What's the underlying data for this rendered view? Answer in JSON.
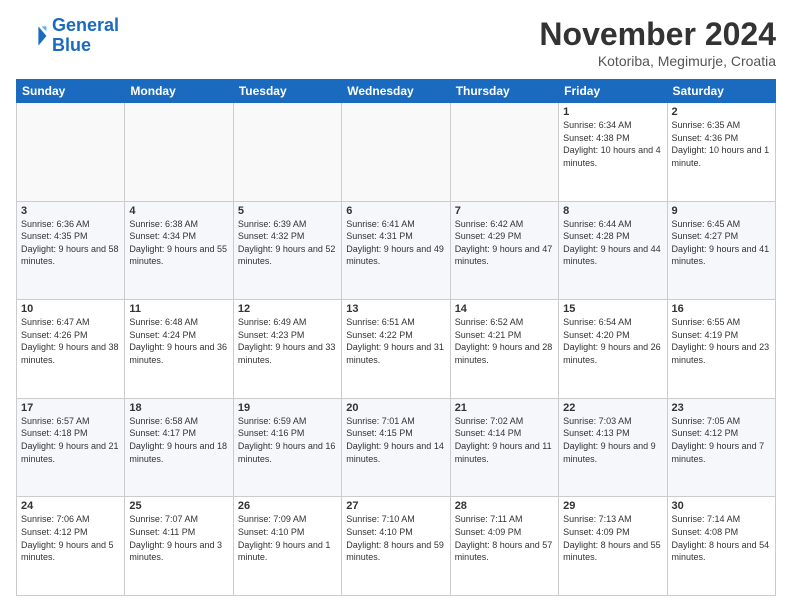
{
  "logo": {
    "line1": "General",
    "line2": "Blue"
  },
  "title": "November 2024",
  "subtitle": "Kotoriba, Megimurje, Croatia",
  "weekdays": [
    "Sunday",
    "Monday",
    "Tuesday",
    "Wednesday",
    "Thursday",
    "Friday",
    "Saturday"
  ],
  "weeks": [
    [
      {
        "day": "",
        "info": ""
      },
      {
        "day": "",
        "info": ""
      },
      {
        "day": "",
        "info": ""
      },
      {
        "day": "",
        "info": ""
      },
      {
        "day": "",
        "info": ""
      },
      {
        "day": "1",
        "info": "Sunrise: 6:34 AM\nSunset: 4:38 PM\nDaylight: 10 hours\nand 4 minutes."
      },
      {
        "day": "2",
        "info": "Sunrise: 6:35 AM\nSunset: 4:36 PM\nDaylight: 10 hours\nand 1 minute."
      }
    ],
    [
      {
        "day": "3",
        "info": "Sunrise: 6:36 AM\nSunset: 4:35 PM\nDaylight: 9 hours\nand 58 minutes."
      },
      {
        "day": "4",
        "info": "Sunrise: 6:38 AM\nSunset: 4:34 PM\nDaylight: 9 hours\nand 55 minutes."
      },
      {
        "day": "5",
        "info": "Sunrise: 6:39 AM\nSunset: 4:32 PM\nDaylight: 9 hours\nand 52 minutes."
      },
      {
        "day": "6",
        "info": "Sunrise: 6:41 AM\nSunset: 4:31 PM\nDaylight: 9 hours\nand 49 minutes."
      },
      {
        "day": "7",
        "info": "Sunrise: 6:42 AM\nSunset: 4:29 PM\nDaylight: 9 hours\nand 47 minutes."
      },
      {
        "day": "8",
        "info": "Sunrise: 6:44 AM\nSunset: 4:28 PM\nDaylight: 9 hours\nand 44 minutes."
      },
      {
        "day": "9",
        "info": "Sunrise: 6:45 AM\nSunset: 4:27 PM\nDaylight: 9 hours\nand 41 minutes."
      }
    ],
    [
      {
        "day": "10",
        "info": "Sunrise: 6:47 AM\nSunset: 4:26 PM\nDaylight: 9 hours\nand 38 minutes."
      },
      {
        "day": "11",
        "info": "Sunrise: 6:48 AM\nSunset: 4:24 PM\nDaylight: 9 hours\nand 36 minutes."
      },
      {
        "day": "12",
        "info": "Sunrise: 6:49 AM\nSunset: 4:23 PM\nDaylight: 9 hours\nand 33 minutes."
      },
      {
        "day": "13",
        "info": "Sunrise: 6:51 AM\nSunset: 4:22 PM\nDaylight: 9 hours\nand 31 minutes."
      },
      {
        "day": "14",
        "info": "Sunrise: 6:52 AM\nSunset: 4:21 PM\nDaylight: 9 hours\nand 28 minutes."
      },
      {
        "day": "15",
        "info": "Sunrise: 6:54 AM\nSunset: 4:20 PM\nDaylight: 9 hours\nand 26 minutes."
      },
      {
        "day": "16",
        "info": "Sunrise: 6:55 AM\nSunset: 4:19 PM\nDaylight: 9 hours\nand 23 minutes."
      }
    ],
    [
      {
        "day": "17",
        "info": "Sunrise: 6:57 AM\nSunset: 4:18 PM\nDaylight: 9 hours\nand 21 minutes."
      },
      {
        "day": "18",
        "info": "Sunrise: 6:58 AM\nSunset: 4:17 PM\nDaylight: 9 hours\nand 18 minutes."
      },
      {
        "day": "19",
        "info": "Sunrise: 6:59 AM\nSunset: 4:16 PM\nDaylight: 9 hours\nand 16 minutes."
      },
      {
        "day": "20",
        "info": "Sunrise: 7:01 AM\nSunset: 4:15 PM\nDaylight: 9 hours\nand 14 minutes."
      },
      {
        "day": "21",
        "info": "Sunrise: 7:02 AM\nSunset: 4:14 PM\nDaylight: 9 hours\nand 11 minutes."
      },
      {
        "day": "22",
        "info": "Sunrise: 7:03 AM\nSunset: 4:13 PM\nDaylight: 9 hours\nand 9 minutes."
      },
      {
        "day": "23",
        "info": "Sunrise: 7:05 AM\nSunset: 4:12 PM\nDaylight: 9 hours\nand 7 minutes."
      }
    ],
    [
      {
        "day": "24",
        "info": "Sunrise: 7:06 AM\nSunset: 4:12 PM\nDaylight: 9 hours\nand 5 minutes."
      },
      {
        "day": "25",
        "info": "Sunrise: 7:07 AM\nSunset: 4:11 PM\nDaylight: 9 hours\nand 3 minutes."
      },
      {
        "day": "26",
        "info": "Sunrise: 7:09 AM\nSunset: 4:10 PM\nDaylight: 9 hours\nand 1 minute."
      },
      {
        "day": "27",
        "info": "Sunrise: 7:10 AM\nSunset: 4:10 PM\nDaylight: 8 hours\nand 59 minutes."
      },
      {
        "day": "28",
        "info": "Sunrise: 7:11 AM\nSunset: 4:09 PM\nDaylight: 8 hours\nand 57 minutes."
      },
      {
        "day": "29",
        "info": "Sunrise: 7:13 AM\nSunset: 4:09 PM\nDaylight: 8 hours\nand 55 minutes."
      },
      {
        "day": "30",
        "info": "Sunrise: 7:14 AM\nSunset: 4:08 PM\nDaylight: 8 hours\nand 54 minutes."
      }
    ]
  ]
}
